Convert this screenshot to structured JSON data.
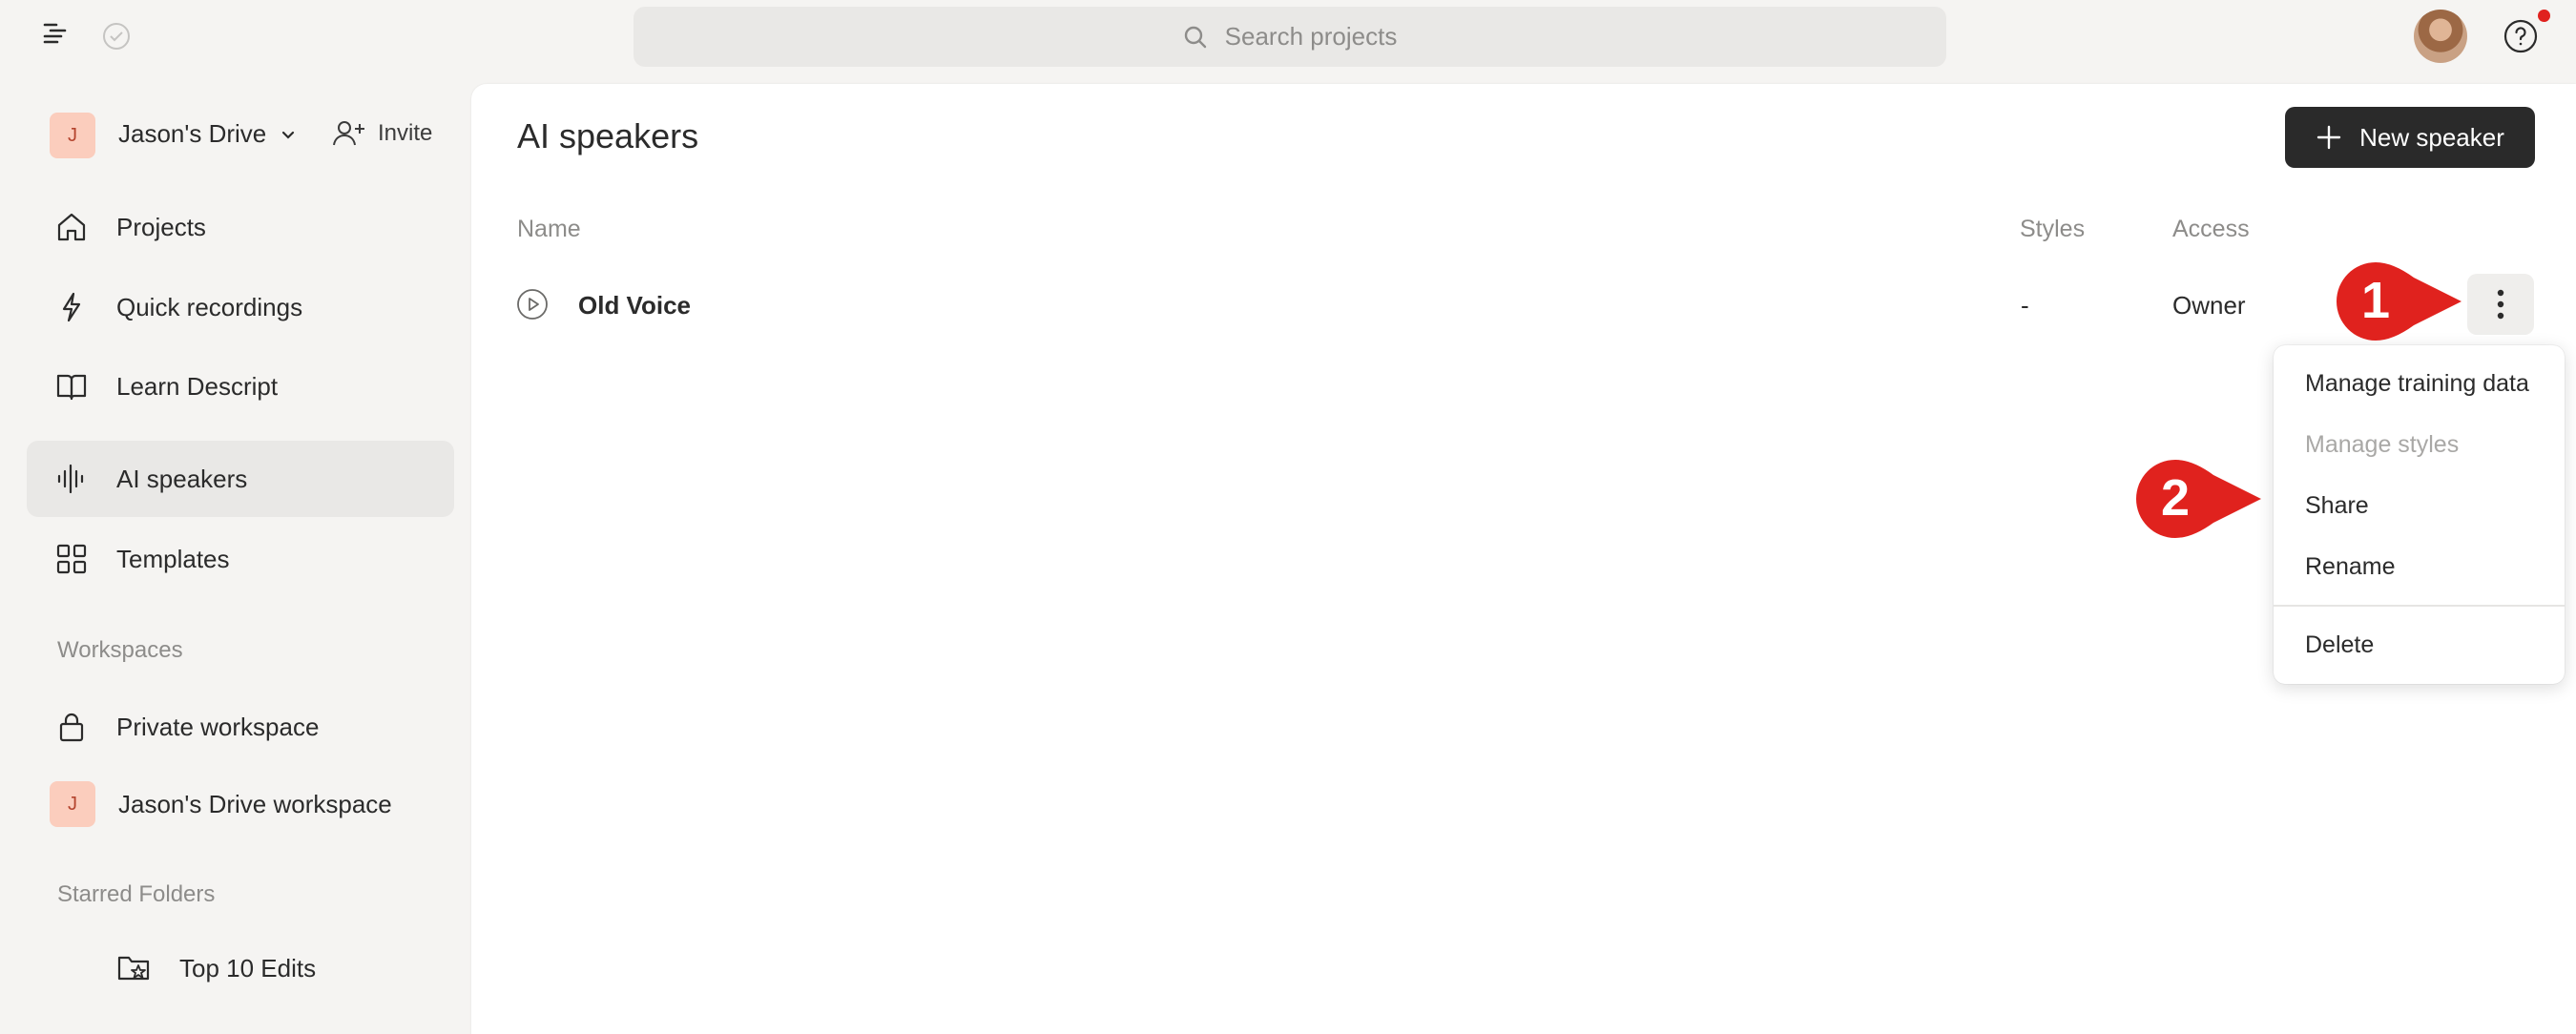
{
  "topbar": {
    "search_placeholder": "Search projects"
  },
  "sidebar": {
    "drive_badge": "J",
    "drive_name": "Jason's Drive",
    "invite_label": "Invite",
    "nav": [
      {
        "label": "Projects",
        "icon": "home-icon"
      },
      {
        "label": "Quick recordings",
        "icon": "lightning-icon"
      },
      {
        "label": "Learn Descript",
        "icon": "book-icon"
      },
      {
        "label": "AI speakers",
        "icon": "waveform-icon",
        "active": true
      },
      {
        "label": "Templates",
        "icon": "grid-icon"
      }
    ],
    "workspaces_label": "Workspaces",
    "workspaces": [
      {
        "label": "Private workspace",
        "icon": "lock-icon"
      },
      {
        "label": "Jason's Drive workspace",
        "badge": "J"
      }
    ],
    "starred_label": "Starred Folders",
    "starred": [
      {
        "label": "Top 10 Edits",
        "icon": "folder-star-icon"
      }
    ]
  },
  "main": {
    "title": "AI speakers",
    "new_button_label": "New speaker",
    "columns": {
      "name": "Name",
      "styles": "Styles",
      "access": "Access"
    },
    "rows": [
      {
        "name": "Old Voice",
        "styles": "-",
        "access": "Owner"
      }
    ]
  },
  "menu": {
    "items": [
      {
        "label": "Manage training data",
        "enabled": true
      },
      {
        "label": "Manage styles",
        "enabled": false
      },
      {
        "label": "Share",
        "enabled": true
      },
      {
        "label": "Rename",
        "enabled": true
      },
      {
        "label": "Delete",
        "enabled": true
      }
    ]
  },
  "callouts": [
    "1",
    "2"
  ],
  "colors": {
    "accent_dark": "#2a2a2a",
    "callout_red": "#e0221e",
    "badge_bg": "#fbcdbd",
    "sidebar_bg": "#f5f4f2"
  }
}
